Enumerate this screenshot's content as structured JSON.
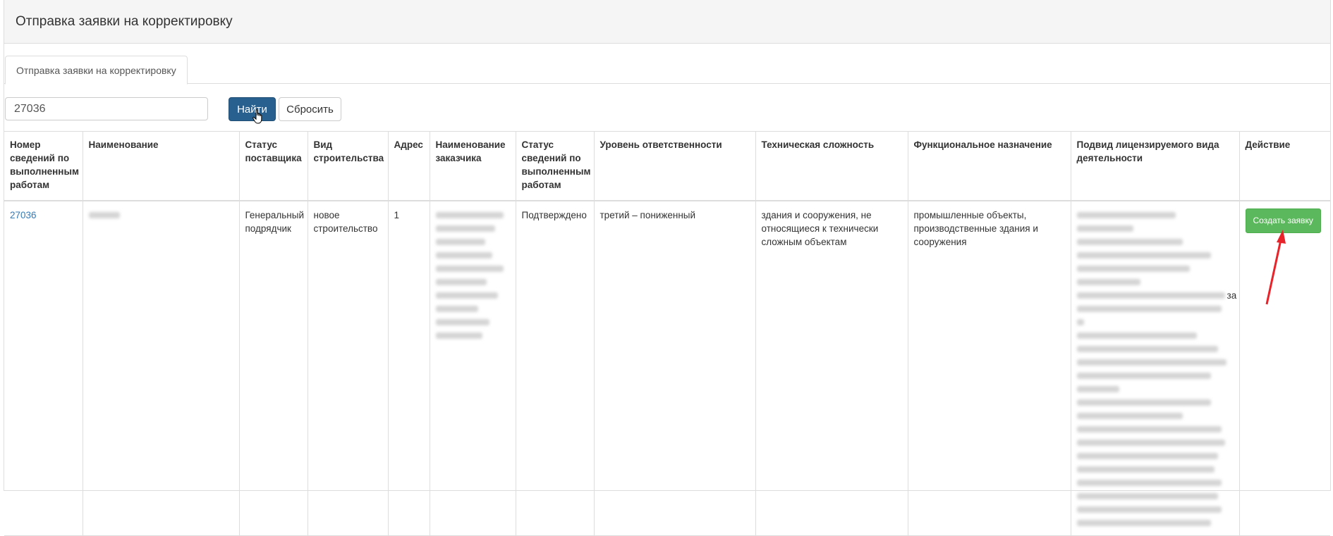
{
  "panel": {
    "title": "Отправка заявки на корректировку"
  },
  "tabs": [
    {
      "label": "Отправка заявки на корректировку",
      "active": true
    }
  ],
  "search": {
    "value": "27036",
    "find_label": "Найти",
    "reset_label": "Сбросить"
  },
  "table": {
    "headers": {
      "number": "Номер сведений по выполненным работам",
      "name": "Наименование",
      "supplier_status": "Статус поставщика",
      "construction_type": "Вид строительства",
      "address": "Адрес",
      "customer_name": "Наименование заказчика",
      "info_status": "Статус сведений по выполненным работам",
      "responsibility_level": "Уровень ответственности",
      "technical_complexity": "Техническая сложность",
      "functional_purpose": "Функциональное назначение",
      "activity_subtype": "Подвид лицензируемого вида деятельности",
      "action": "Действие"
    },
    "rows": [
      {
        "number": "27036",
        "supplier_status": "Генеральный подрядчик",
        "construction_type": "новое строительство",
        "address": "1",
        "info_status": "Подтверждено",
        "responsibility_level": "третий – пониженный",
        "technical_complexity": "здания и сооружения, не относящиеся к технически сложным объектам",
        "functional_purpose": "промышленные объекты, производственные здания и сооружения",
        "activity_subtype_visible_fragment": "за",
        "action_label": "Создать заявку"
      }
    ]
  },
  "colors": {
    "primary_button": "#286090",
    "success_button": "#5cb85c",
    "link": "#337ab7",
    "annotation_arrow": "#e8232a"
  }
}
